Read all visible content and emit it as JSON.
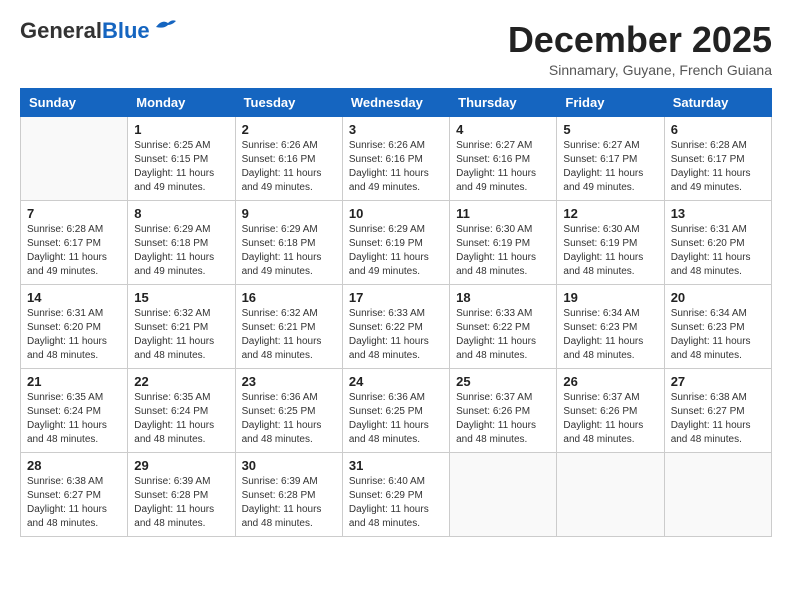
{
  "logo": {
    "general": "General",
    "blue": "Blue"
  },
  "title": "December 2025",
  "subtitle": "Sinnamary, Guyane, French Guiana",
  "days_of_week": [
    "Sunday",
    "Monday",
    "Tuesday",
    "Wednesday",
    "Thursday",
    "Friday",
    "Saturday"
  ],
  "weeks": [
    [
      {
        "day": "",
        "sunrise": "",
        "sunset": "",
        "daylight": ""
      },
      {
        "day": "1",
        "sunrise": "Sunrise: 6:25 AM",
        "sunset": "Sunset: 6:15 PM",
        "daylight": "Daylight: 11 hours and 49 minutes."
      },
      {
        "day": "2",
        "sunrise": "Sunrise: 6:26 AM",
        "sunset": "Sunset: 6:16 PM",
        "daylight": "Daylight: 11 hours and 49 minutes."
      },
      {
        "day": "3",
        "sunrise": "Sunrise: 6:26 AM",
        "sunset": "Sunset: 6:16 PM",
        "daylight": "Daylight: 11 hours and 49 minutes."
      },
      {
        "day": "4",
        "sunrise": "Sunrise: 6:27 AM",
        "sunset": "Sunset: 6:16 PM",
        "daylight": "Daylight: 11 hours and 49 minutes."
      },
      {
        "day": "5",
        "sunrise": "Sunrise: 6:27 AM",
        "sunset": "Sunset: 6:17 PM",
        "daylight": "Daylight: 11 hours and 49 minutes."
      },
      {
        "day": "6",
        "sunrise": "Sunrise: 6:28 AM",
        "sunset": "Sunset: 6:17 PM",
        "daylight": "Daylight: 11 hours and 49 minutes."
      }
    ],
    [
      {
        "day": "7",
        "sunrise": "Sunrise: 6:28 AM",
        "sunset": "Sunset: 6:17 PM",
        "daylight": "Daylight: 11 hours and 49 minutes."
      },
      {
        "day": "8",
        "sunrise": "Sunrise: 6:29 AM",
        "sunset": "Sunset: 6:18 PM",
        "daylight": "Daylight: 11 hours and 49 minutes."
      },
      {
        "day": "9",
        "sunrise": "Sunrise: 6:29 AM",
        "sunset": "Sunset: 6:18 PM",
        "daylight": "Daylight: 11 hours and 49 minutes."
      },
      {
        "day": "10",
        "sunrise": "Sunrise: 6:29 AM",
        "sunset": "Sunset: 6:19 PM",
        "daylight": "Daylight: 11 hours and 49 minutes."
      },
      {
        "day": "11",
        "sunrise": "Sunrise: 6:30 AM",
        "sunset": "Sunset: 6:19 PM",
        "daylight": "Daylight: 11 hours and 48 minutes."
      },
      {
        "day": "12",
        "sunrise": "Sunrise: 6:30 AM",
        "sunset": "Sunset: 6:19 PM",
        "daylight": "Daylight: 11 hours and 48 minutes."
      },
      {
        "day": "13",
        "sunrise": "Sunrise: 6:31 AM",
        "sunset": "Sunset: 6:20 PM",
        "daylight": "Daylight: 11 hours and 48 minutes."
      }
    ],
    [
      {
        "day": "14",
        "sunrise": "Sunrise: 6:31 AM",
        "sunset": "Sunset: 6:20 PM",
        "daylight": "Daylight: 11 hours and 48 minutes."
      },
      {
        "day": "15",
        "sunrise": "Sunrise: 6:32 AM",
        "sunset": "Sunset: 6:21 PM",
        "daylight": "Daylight: 11 hours and 48 minutes."
      },
      {
        "day": "16",
        "sunrise": "Sunrise: 6:32 AM",
        "sunset": "Sunset: 6:21 PM",
        "daylight": "Daylight: 11 hours and 48 minutes."
      },
      {
        "day": "17",
        "sunrise": "Sunrise: 6:33 AM",
        "sunset": "Sunset: 6:22 PM",
        "daylight": "Daylight: 11 hours and 48 minutes."
      },
      {
        "day": "18",
        "sunrise": "Sunrise: 6:33 AM",
        "sunset": "Sunset: 6:22 PM",
        "daylight": "Daylight: 11 hours and 48 minutes."
      },
      {
        "day": "19",
        "sunrise": "Sunrise: 6:34 AM",
        "sunset": "Sunset: 6:23 PM",
        "daylight": "Daylight: 11 hours and 48 minutes."
      },
      {
        "day": "20",
        "sunrise": "Sunrise: 6:34 AM",
        "sunset": "Sunset: 6:23 PM",
        "daylight": "Daylight: 11 hours and 48 minutes."
      }
    ],
    [
      {
        "day": "21",
        "sunrise": "Sunrise: 6:35 AM",
        "sunset": "Sunset: 6:24 PM",
        "daylight": "Daylight: 11 hours and 48 minutes."
      },
      {
        "day": "22",
        "sunrise": "Sunrise: 6:35 AM",
        "sunset": "Sunset: 6:24 PM",
        "daylight": "Daylight: 11 hours and 48 minutes."
      },
      {
        "day": "23",
        "sunrise": "Sunrise: 6:36 AM",
        "sunset": "Sunset: 6:25 PM",
        "daylight": "Daylight: 11 hours and 48 minutes."
      },
      {
        "day": "24",
        "sunrise": "Sunrise: 6:36 AM",
        "sunset": "Sunset: 6:25 PM",
        "daylight": "Daylight: 11 hours and 48 minutes."
      },
      {
        "day": "25",
        "sunrise": "Sunrise: 6:37 AM",
        "sunset": "Sunset: 6:26 PM",
        "daylight": "Daylight: 11 hours and 48 minutes."
      },
      {
        "day": "26",
        "sunrise": "Sunrise: 6:37 AM",
        "sunset": "Sunset: 6:26 PM",
        "daylight": "Daylight: 11 hours and 48 minutes."
      },
      {
        "day": "27",
        "sunrise": "Sunrise: 6:38 AM",
        "sunset": "Sunset: 6:27 PM",
        "daylight": "Daylight: 11 hours and 48 minutes."
      }
    ],
    [
      {
        "day": "28",
        "sunrise": "Sunrise: 6:38 AM",
        "sunset": "Sunset: 6:27 PM",
        "daylight": "Daylight: 11 hours and 48 minutes."
      },
      {
        "day": "29",
        "sunrise": "Sunrise: 6:39 AM",
        "sunset": "Sunset: 6:28 PM",
        "daylight": "Daylight: 11 hours and 48 minutes."
      },
      {
        "day": "30",
        "sunrise": "Sunrise: 6:39 AM",
        "sunset": "Sunset: 6:28 PM",
        "daylight": "Daylight: 11 hours and 48 minutes."
      },
      {
        "day": "31",
        "sunrise": "Sunrise: 6:40 AM",
        "sunset": "Sunset: 6:29 PM",
        "daylight": "Daylight: 11 hours and 48 minutes."
      },
      {
        "day": "",
        "sunrise": "",
        "sunset": "",
        "daylight": ""
      },
      {
        "day": "",
        "sunrise": "",
        "sunset": "",
        "daylight": ""
      },
      {
        "day": "",
        "sunrise": "",
        "sunset": "",
        "daylight": ""
      }
    ]
  ]
}
